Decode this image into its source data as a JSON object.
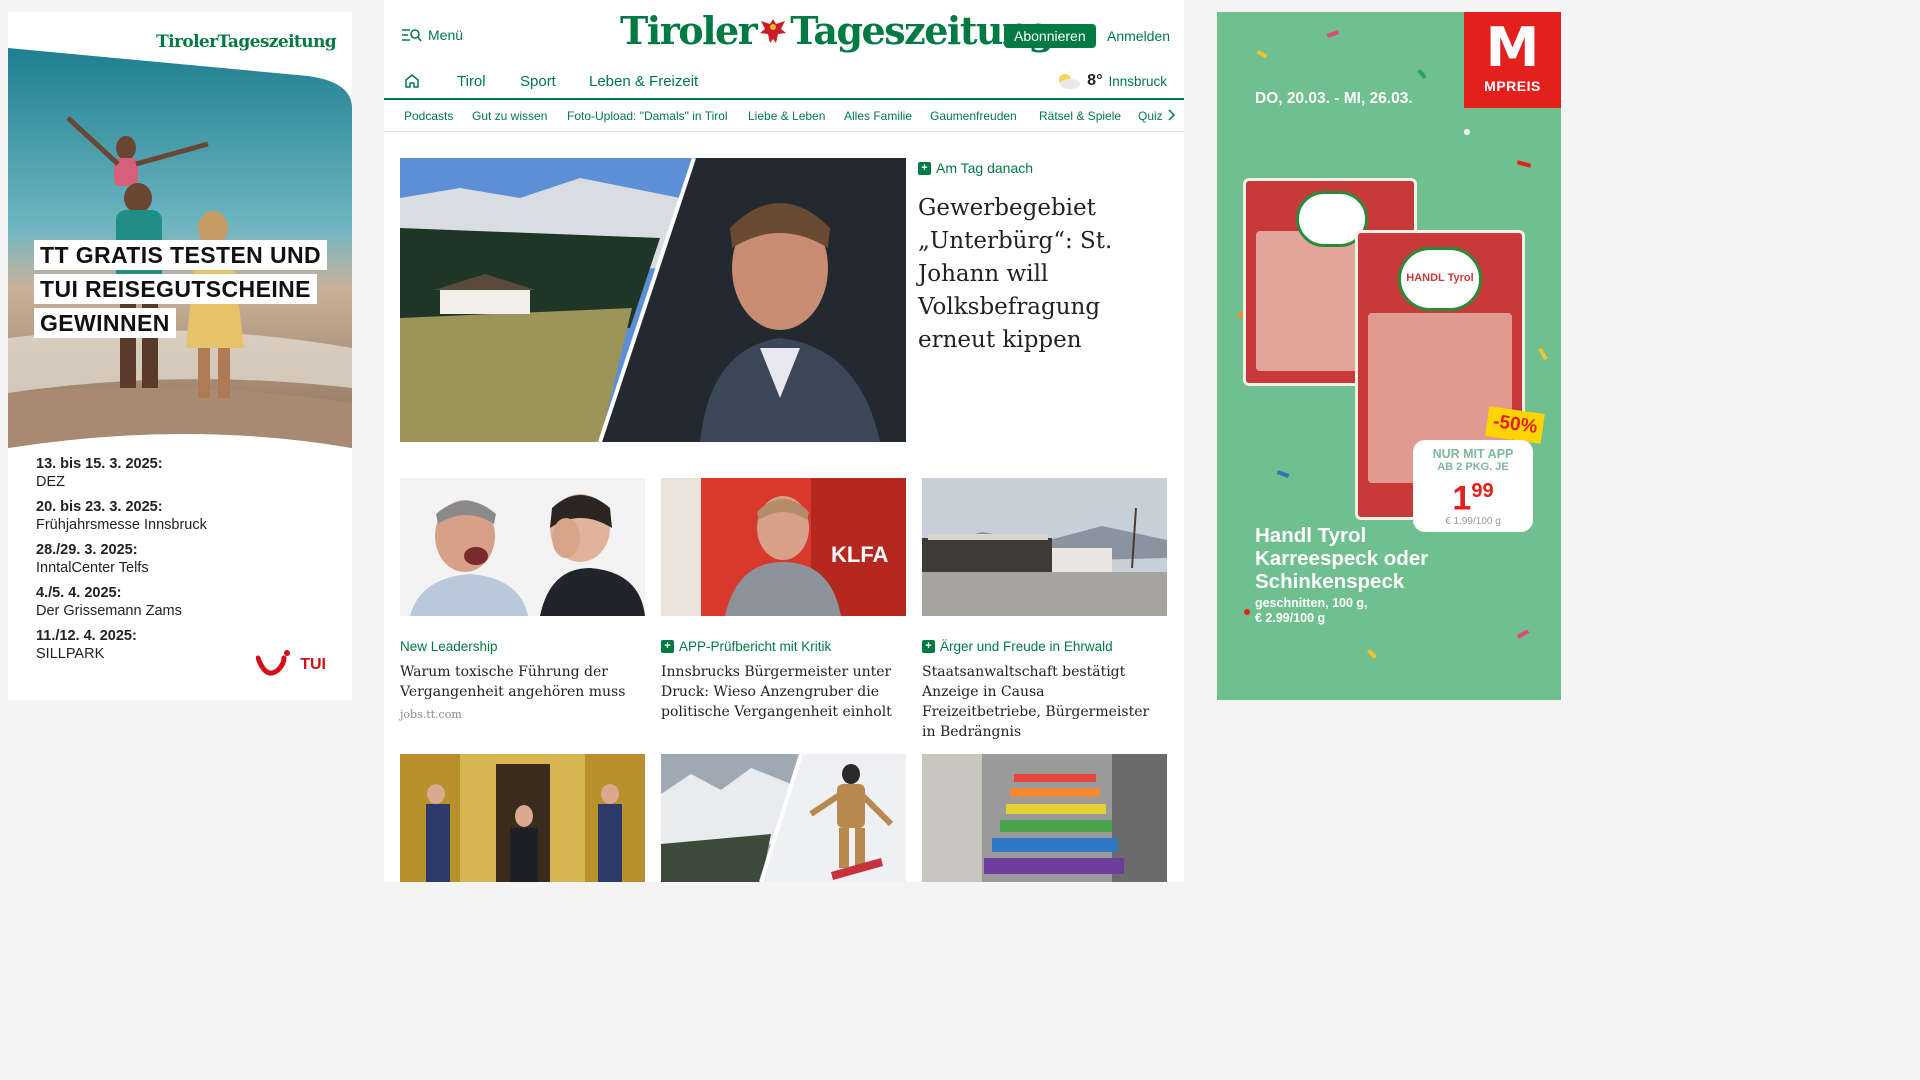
{
  "ad_left": {
    "brand": "TirolerTageszeitung",
    "headline": [
      "TT GRATIS TESTEN UND",
      "TUI REISEGUTSCHEINE",
      "GEWINNEN"
    ],
    "events": [
      {
        "date": "13. bis 15. 3. 2025:",
        "place": "DEZ"
      },
      {
        "date": "20. bis 23. 3. 2025:",
        "place": "Frühjahrsmesse Innsbruck"
      },
      {
        "date": "28./29. 3. 2025:",
        "place": "InntalCenter Telfs"
      },
      {
        "date": "4./5. 4. 2025:",
        "place": "Der Grissemann Zams"
      },
      {
        "date": "11./12. 4. 2025:",
        "place": "SILLPARK"
      }
    ],
    "sponsor": "TUI"
  },
  "header": {
    "menu_label": "Menü",
    "logo_left": "Tiroler",
    "logo_right": "Tageszeitung",
    "subscribe_label": "Abonnieren",
    "login_label": "Anmelden"
  },
  "nav": {
    "items": [
      "Tirol",
      "Sport",
      "Leben & Freizeit"
    ],
    "weather_temp": "8°",
    "weather_city": "Innsbruck"
  },
  "subnav": [
    "Podcasts",
    "Gut zu wissen",
    "Foto-Upload: \"Damals\" in Tirol",
    "Liebe & Leben",
    "Alles Familie",
    "Gaumenfreuden",
    "Rätsel & Spiele",
    "Quiz"
  ],
  "hero": {
    "kicker": "Am Tag danach",
    "title": "Gewerbegebiet „Unterbürg“: St. Johann will Volksbefragung erneut kippen"
  },
  "cards": [
    {
      "kicker": "New Leadership",
      "premium": false,
      "title": "Warum toxische Führung der Vergangenheit angehören muss",
      "source": "jobs.tt.com"
    },
    {
      "kicker": "APP-Prüfbericht mit Kritik",
      "premium": true,
      "title": "Innsbrucks Bürgermeister unter Druck: Wieso Anzengruber die politische Vergangenheit einholt",
      "source": ""
    },
    {
      "kicker": "Ärger und Freude in Ehrwald",
      "premium": true,
      "title": "Staatsanwaltschaft bestätigt Anzeige in Causa Freizeitbetriebe, Bürgermeister in Bedrängnis",
      "source": ""
    }
  ],
  "ad_right": {
    "logo_letter": "M",
    "logo_name": "MPREIS",
    "dates": "DO, 20.03. - MI, 26.03.",
    "discount": "-50%",
    "price_line1": "NUR MIT APP",
    "price_line2": "AB 2 PKG. JE",
    "price": "1",
    "price_cents": "99",
    "unit_price": "€ 1.99/100 g",
    "product": "Handl Tyrol Karreespeck oder Schinkenspeck",
    "product_sub_1": "geschnitten, 100 g,",
    "product_sub_2": "€ 2.99/100 g",
    "pack_brand": "HANDL Tyrol"
  },
  "colors": {
    "brand_green": "#007a43",
    "mpreis_red": "#e3201c",
    "tui_red": "#d40e14"
  }
}
